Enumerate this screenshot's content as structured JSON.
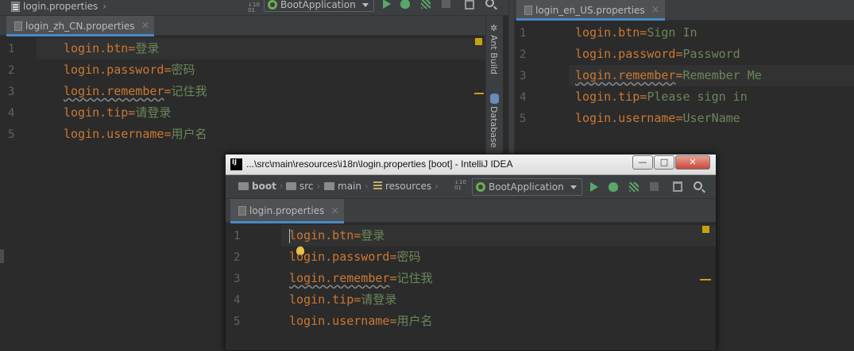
{
  "left_editor": {
    "breadcrumb": "login.properties",
    "run_config": "BootApplication",
    "tab_label": "login_zh_CN.properties",
    "lines": [
      {
        "num": "1",
        "key": "login.btn",
        "eq": "=",
        "value": "登录"
      },
      {
        "num": "2",
        "key": "login.password",
        "eq": "=",
        "value": "密码"
      },
      {
        "num": "3",
        "key": "login.remember",
        "eq": "=",
        "value": "记住我"
      },
      {
        "num": "4",
        "key": "login.tip",
        "eq": "=",
        "value": "请登录"
      },
      {
        "num": "5",
        "key": "login.username",
        "eq": "=",
        "value": "用户名"
      }
    ]
  },
  "side_strip": {
    "ant_build": "Ant Build",
    "database": "Database"
  },
  "right_editor": {
    "tab_label": "login_en_US.properties",
    "lines": [
      {
        "num": "1",
        "key": "login.btn",
        "eq": "=",
        "value": "Sign In"
      },
      {
        "num": "2",
        "key": "login.password",
        "eq": "=",
        "value": "Password"
      },
      {
        "num": "3",
        "key": "login.remember",
        "eq": "=",
        "value": "Remember Me"
      },
      {
        "num": "4",
        "key": "login.tip",
        "eq": "=",
        "value": "Please sign in"
      },
      {
        "num": "5",
        "key": "login.username",
        "eq": "=",
        "value": "UserName"
      }
    ]
  },
  "floating_window": {
    "title": "...\\src\\main\\resources\\i18n\\login.properties [boot] - IntelliJ IDEA",
    "buttons": {
      "minimize": "—",
      "maximize": "□",
      "close": "✕"
    },
    "breadcrumbs": [
      "boot",
      "src",
      "main",
      "resources"
    ],
    "run_config": "BootApplication",
    "tab_label": "login.properties",
    "lines": [
      {
        "num": "1",
        "key": "login.btn",
        "eq": "=",
        "value": "登录"
      },
      {
        "num": "2",
        "key": "login.password",
        "eq": "=",
        "value": "密码"
      },
      {
        "num": "3",
        "key": "login.remember",
        "eq": "=",
        "value": "记住我"
      },
      {
        "num": "4",
        "key": "login.tip",
        "eq": "=",
        "value": "请登录"
      },
      {
        "num": "5",
        "key": "login.username",
        "eq": "=",
        "value": "用户名"
      }
    ]
  },
  "colors": {
    "key": "#cc7832",
    "value": "#6a8759",
    "background": "#2b2b2b",
    "panel": "#3c3f41",
    "tab_underline": "#4a88c7"
  }
}
